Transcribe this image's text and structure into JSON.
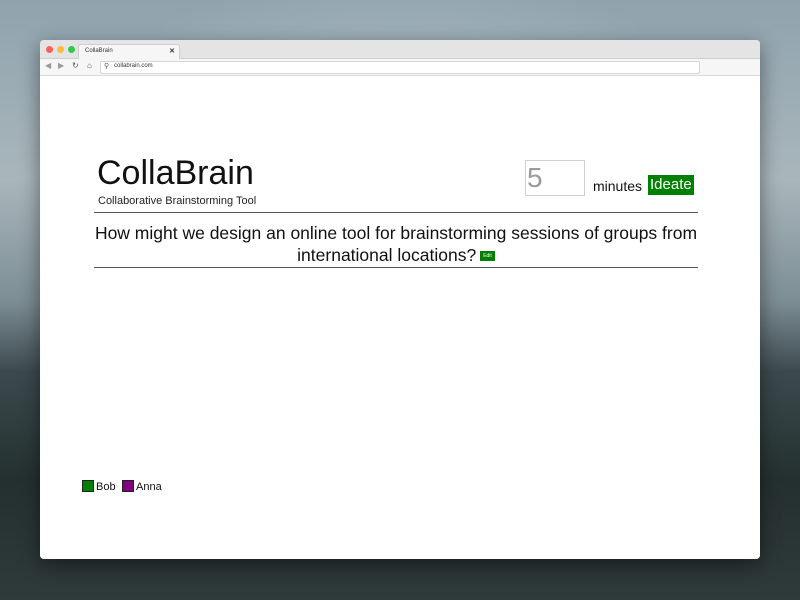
{
  "browser": {
    "tab_title": "CollaBrain",
    "tab_close": "✕",
    "url": "collabrain.com",
    "nav": {
      "back": "◀",
      "forward": "▶",
      "reload": "↻",
      "home": "⌂",
      "search_icon": "⚲"
    }
  },
  "app": {
    "title": "CollaBrain",
    "subtitle": "Collaborative Brainstorming Tool"
  },
  "timer": {
    "value": "",
    "placeholder": "5",
    "unit_label": "minutes",
    "ideate_label": "Ideate"
  },
  "question": {
    "text": "How might we design an online tool for brainstorming sessions of groups from international locations?",
    "edit_label": "Edit"
  },
  "users": [
    {
      "name": "Bob",
      "color": "#008000"
    },
    {
      "name": "Anna",
      "color": "#800080"
    }
  ],
  "colors": {
    "accent": "#008000"
  }
}
